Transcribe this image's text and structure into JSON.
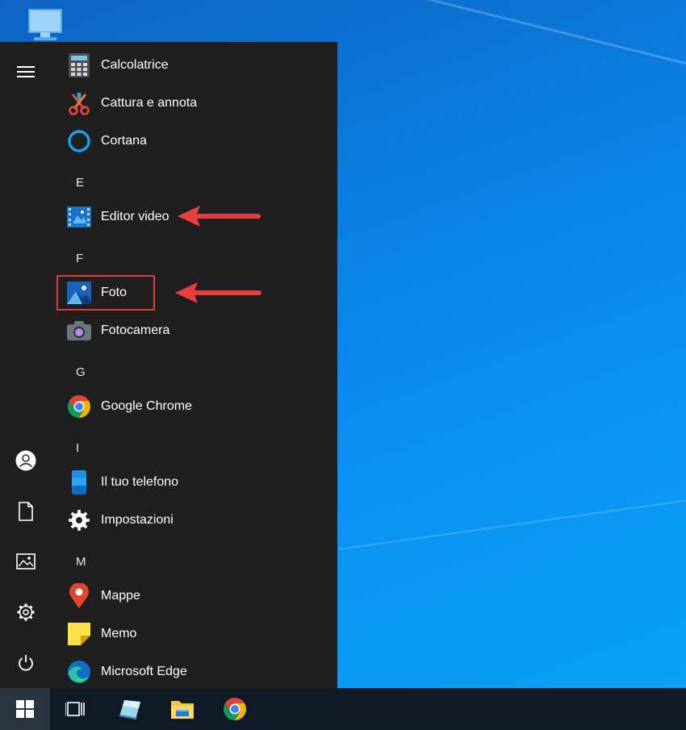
{
  "start_menu": {
    "groups": [
      {
        "letter": "",
        "items": [
          {
            "label": "Calcolatrice",
            "icon": "calculator-icon"
          },
          {
            "label": "Cattura e annota",
            "icon": "snip-sketch-icon"
          },
          {
            "label": "Cortana",
            "icon": "cortana-icon"
          }
        ]
      },
      {
        "letter": "E",
        "items": [
          {
            "label": "Editor video",
            "icon": "video-editor-icon"
          }
        ]
      },
      {
        "letter": "F",
        "items": [
          {
            "label": "Foto",
            "icon": "photos-icon"
          },
          {
            "label": "Fotocamera",
            "icon": "camera-icon"
          }
        ]
      },
      {
        "letter": "G",
        "items": [
          {
            "label": "Google Chrome",
            "icon": "chrome-icon"
          }
        ]
      },
      {
        "letter": "I",
        "items": [
          {
            "label": "Il tuo telefono",
            "icon": "your-phone-icon"
          },
          {
            "label": "Impostazioni",
            "icon": "settings-gear-icon"
          }
        ]
      },
      {
        "letter": "M",
        "items": [
          {
            "label": "Mappe",
            "icon": "maps-icon"
          },
          {
            "label": "Memo",
            "icon": "sticky-notes-icon"
          },
          {
            "label": "Microsoft Edge",
            "icon": "edge-icon"
          }
        ]
      }
    ]
  },
  "rail": [
    "hamburger-menu-icon",
    "user-icon",
    "documents-icon",
    "pictures-icon",
    "settings-icon",
    "power-icon"
  ],
  "taskbar": [
    "windows-start-icon",
    "task-view-icon",
    "edge-legacy-icon",
    "file-explorer-icon",
    "chrome-icon"
  ],
  "colors": {
    "menu_bg": "#1f1f1f",
    "taskbar_bg": "#101a24",
    "highlight": "#e33b3b",
    "desktop": "#0a7fe0"
  }
}
